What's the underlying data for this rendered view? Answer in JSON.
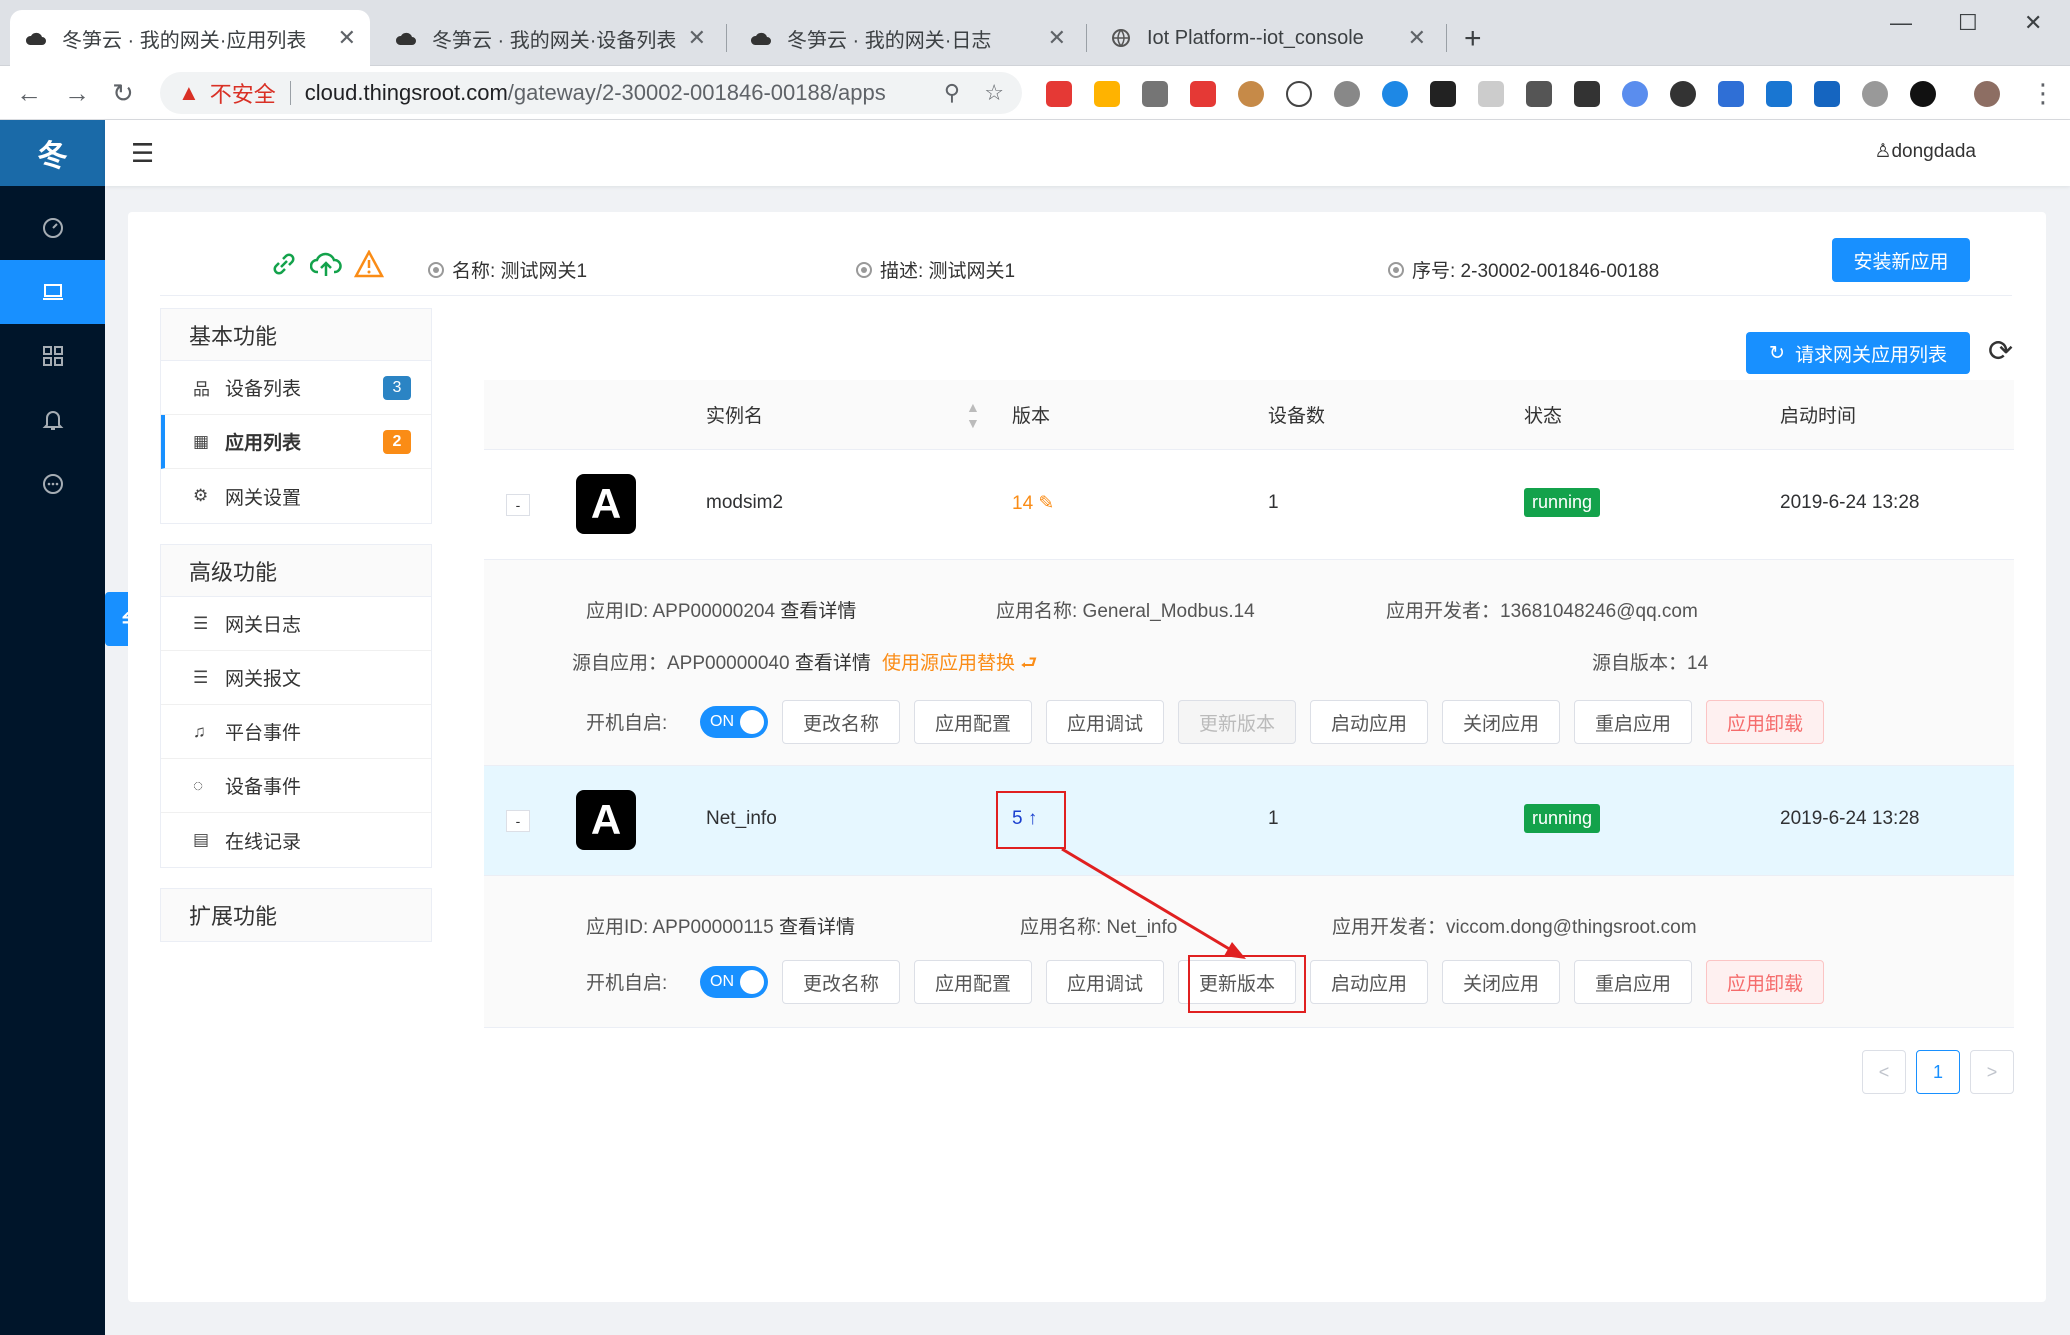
{
  "browser": {
    "tabs": [
      {
        "label": "冬笋云 · 我的网关·应用列表",
        "active": true
      },
      {
        "label": "冬笋云 · 我的网关·设备列表",
        "active": false
      },
      {
        "label": "冬笋云 · 我的网关·日志",
        "active": false
      },
      {
        "label": "Iot Platform--iot_console",
        "active": false
      }
    ],
    "security_label": "不安全",
    "url_host": "cloud.thingsroot.com",
    "url_path": "/gateway/2-30002-001846-00188/apps"
  },
  "app": {
    "logo": "冬",
    "username": "dongdada"
  },
  "gateway": {
    "name_label": "名称: 测试网关1",
    "desc_label": "描述: 测试网关1",
    "serial_label": "序号: 2-30002-001846-00188",
    "install_button": "安装新应用"
  },
  "leftnav": {
    "basic_title": "基本功能",
    "basic_items": [
      {
        "label": "设备列表",
        "badge": "3"
      },
      {
        "label": "应用列表",
        "badge": "2"
      },
      {
        "label": "网关设置",
        "badge": ""
      }
    ],
    "advanced_title": "高级功能",
    "advanced_items": [
      {
        "label": "网关日志"
      },
      {
        "label": "网关报文"
      },
      {
        "label": "平台事件"
      },
      {
        "label": "设备事件"
      },
      {
        "label": "在线记录"
      }
    ],
    "extension_title": "扩展功能"
  },
  "toolbar": {
    "refresh_button": "请求网关应用列表"
  },
  "table": {
    "headers": [
      "实例名",
      "版本",
      "设备数",
      "状态",
      "启动时间"
    ],
    "rows": [
      {
        "icon_letter": "A",
        "name": "modsim2",
        "version": "14",
        "devices": "1",
        "status": "running",
        "start_time": "2019-6-24 13:28",
        "detail": {
          "app_id": "应用ID: APP00000204",
          "view_detail": "查看详情",
          "app_name": "应用名称: General_Modbus.14",
          "developer": "应用开发者：13681048246@qq.com",
          "source_app": "源自应用：APP00000040",
          "source_detail": "查看详情",
          "replace_link": "使用源应用替换",
          "source_version": "源自版本：14"
        }
      },
      {
        "icon_letter": "A",
        "name": "Net_info",
        "version": "5",
        "devices": "1",
        "status": "running",
        "start_time": "2019-6-24 13:28",
        "detail": {
          "app_id": "应用ID: APP00000115",
          "view_detail": "查看详情",
          "app_name": "应用名称: Net_info",
          "developer": "应用开发者：viccom.dong@thingsroot.com"
        }
      }
    ],
    "autostart_label": "开机自启:",
    "switch_label": "ON",
    "actions": [
      "更改名称",
      "应用配置",
      "应用调试",
      "更新版本",
      "启动应用",
      "关闭应用",
      "重启应用",
      "应用卸载"
    ]
  },
  "pagination": {
    "prev": "<",
    "current": "1",
    "next": ">"
  },
  "colors": {
    "primary": "#1890ff",
    "sidebar": "#00152a",
    "running": "#13a24b",
    "warning": "#fa8c16",
    "annotation": "#e02020"
  }
}
